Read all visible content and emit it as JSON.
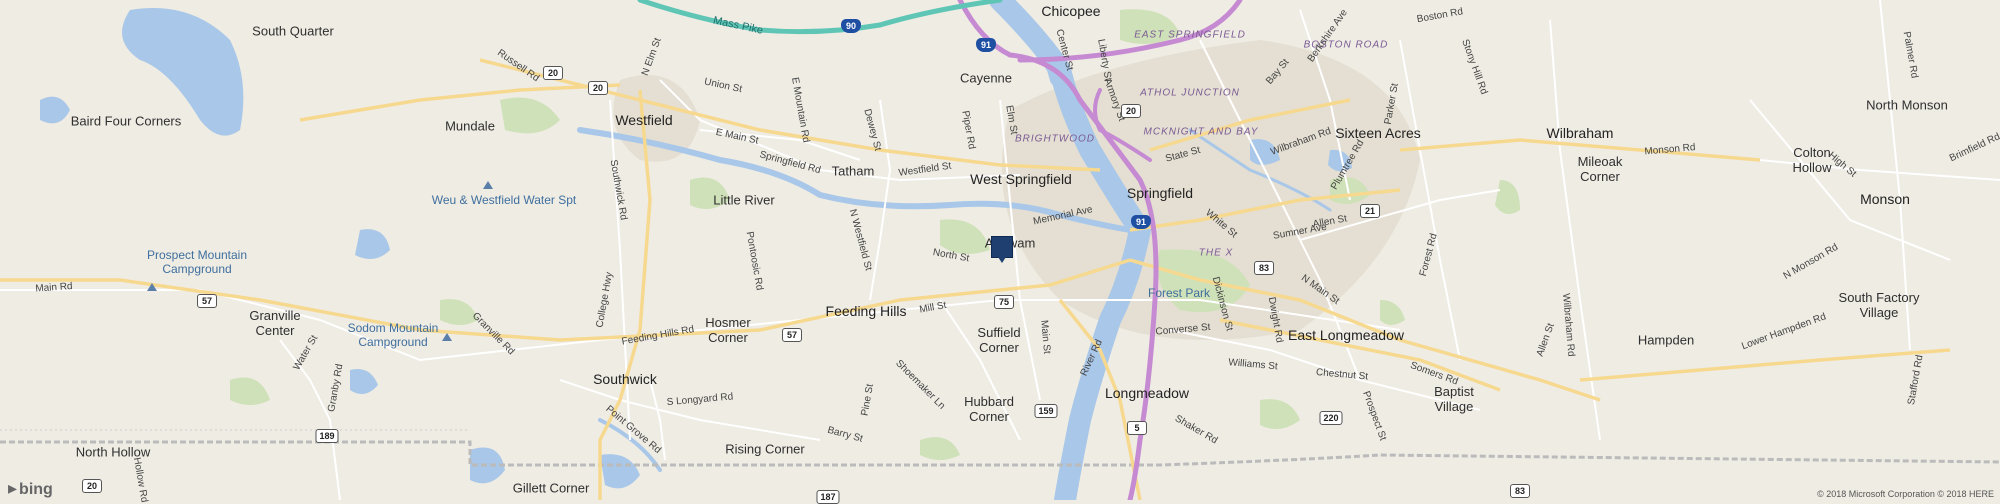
{
  "map": {
    "provider_logo": "bing",
    "copyright": "© 2018 Microsoft Corporation © 2018 HERE",
    "colors": {
      "land": "#efece4",
      "water": "#a9c7e8",
      "park": "#cfe1b8",
      "urban": "#e4dfd2",
      "highway_interstate": "#c58ad2",
      "highway_mass_pike": "#5fc6b6",
      "road_major": "#f6d98f",
      "road_minor": "#ffffff",
      "pin": "#1f3f70"
    }
  },
  "labels": {
    "towns": [
      "South Quarter",
      "Baird Four Corners",
      "Mundale",
      "Westfield",
      "Little River",
      "Tatham",
      "Cayenne",
      "Chicopee",
      "West Springfield",
      "Springfield",
      "Agawam",
      "Feeding Hills",
      "Suffield Corner",
      "Hubbard Corner",
      "Longmeadow",
      "East Longmeadow",
      "Sixteen Acres",
      "Wilbraham",
      "Mileoak Corner",
      "Colton Hollow",
      "North Monson",
      "Monson",
      "South Factory Village",
      "Hampden",
      "Baptist Village",
      "Granville Center",
      "Hosmer Corner",
      "Southwick",
      "Rising Corner",
      "North Hollow",
      "Gillett Corner"
    ],
    "neighborhoods": [
      "EAST SPRINGFIELD",
      "BOSTON ROAD",
      "ATHOL JUNCTION",
      "MCKNIGHT AND BAY",
      "BRIGHTWOOD",
      "THE X"
    ],
    "parks": [
      "Weu & Westfield Water Spt",
      "Prospect Mountain Campground",
      "Sodom Mountain Campground",
      "Forest Park"
    ],
    "roads": [
      "Mass Pike",
      "Union St",
      "E Main St",
      "E Mountain Rd",
      "Springfield Rd",
      "Westfield St",
      "Dewey St",
      "Piper Rd",
      "Elm St",
      "Memorial Ave",
      "North St",
      "Mill St",
      "Feeding Hills Rd",
      "Main Rd",
      "Granville Rd",
      "Russell Rd",
      "N Elm St",
      "Southwick Rd",
      "College Hwy",
      "Pontoosic Rd",
      "N Westfield St",
      "Shoemaker Ln",
      "Pine St",
      "Barry St",
      "S Longyard Rd",
      "Point Grove Rd",
      "Granby Rd",
      "Water St",
      "River Rd",
      "Main St",
      "Converse St",
      "Dickinson St",
      "Sumner Ave",
      "Allen St",
      "White St",
      "State St",
      "Wilbraham Rd",
      "Bay St",
      "Berkshire Ave",
      "Boston Rd",
      "Plumtree Rd",
      "Parker St",
      "Stony Hill Rd",
      "Forest Rd",
      "N Main St",
      "Dwight Rd",
      "Williams St",
      "Chestnut St",
      "Somers Rd",
      "Prospect St",
      "Shaker Rd",
      "Monson Rd",
      "High St",
      "Brimfield Rd",
      "Palmer Rd",
      "N Monson Rd",
      "Lower Hampden Rd",
      "Stafford Rd",
      "Wilbraham Rd",
      "Allen St",
      "Center St",
      "Liberty St",
      "Armory St",
      "Hollow Rd"
    ],
    "shields": [
      "20",
      "20",
      "20",
      "57",
      "57",
      "75",
      "159",
      "5",
      "83",
      "21",
      "220",
      "189",
      "187",
      "83",
      "20"
    ],
    "interstates": [
      "90",
      "91",
      "91"
    ]
  }
}
